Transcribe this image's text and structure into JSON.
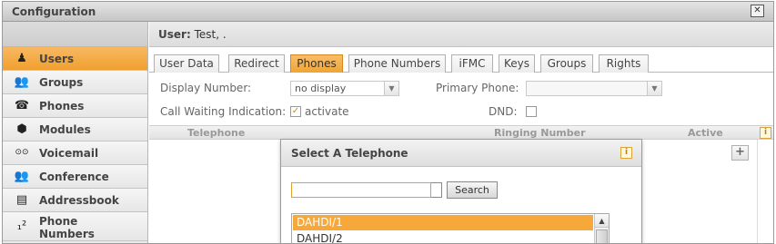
{
  "window": {
    "title": "Configuration",
    "close_symbol": "✕"
  },
  "sidebar": {
    "items": [
      {
        "label": "Users",
        "icon": "user-icon",
        "glyph": "♟",
        "active": true
      },
      {
        "label": "Groups",
        "icon": "group-icon",
        "glyph": "👥"
      },
      {
        "label": "Phones",
        "icon": "phone-icon",
        "glyph": "☎"
      },
      {
        "label": "Modules",
        "icon": "module-icon",
        "glyph": "⬢"
      },
      {
        "label": "Voicemail",
        "icon": "voicemail-icon",
        "glyph": "⊙⊙"
      },
      {
        "label": "Conference",
        "icon": "conference-icon",
        "glyph": "👥"
      },
      {
        "label": "Addressbook",
        "icon": "addressbook-icon",
        "glyph": "▤"
      },
      {
        "label": "Phone\nNumbers",
        "label_line1": "Phone",
        "label_line2": "Numbers",
        "icon": "phone-numbers-icon",
        "glyph": "₁²"
      }
    ]
  },
  "user": {
    "prefix": "User:",
    "name": "Test, ."
  },
  "tabs": [
    "User Data",
    "Redirect",
    "Phones",
    "Phone Numbers",
    "iFMC",
    "Keys",
    "Groups",
    "Rights"
  ],
  "active_tab": "Phones",
  "form": {
    "display_number_label": "Display Number:",
    "display_number_value": "no display",
    "primary_phone_label": "Primary Phone:",
    "primary_phone_value": "",
    "call_waiting_label": "Call Waiting Indication:",
    "call_waiting_checked": true,
    "call_waiting_text": "activate",
    "dnd_label": "DND:",
    "dnd_checked": false
  },
  "table": {
    "headers": {
      "telephone": "Telephone",
      "ringing_number": "Ringing Number",
      "active": "Active"
    },
    "info_symbol": "i",
    "add_symbol": "+"
  },
  "dialog": {
    "title": "Select A Telephone",
    "info_symbol": "i",
    "search_value": "",
    "search_button": "Search",
    "items": [
      "DAHDI/1",
      "DAHDI/2"
    ],
    "selected_index": 0
  },
  "colors": {
    "accent": "#f0a030",
    "selected_row": "#f7a83a"
  }
}
